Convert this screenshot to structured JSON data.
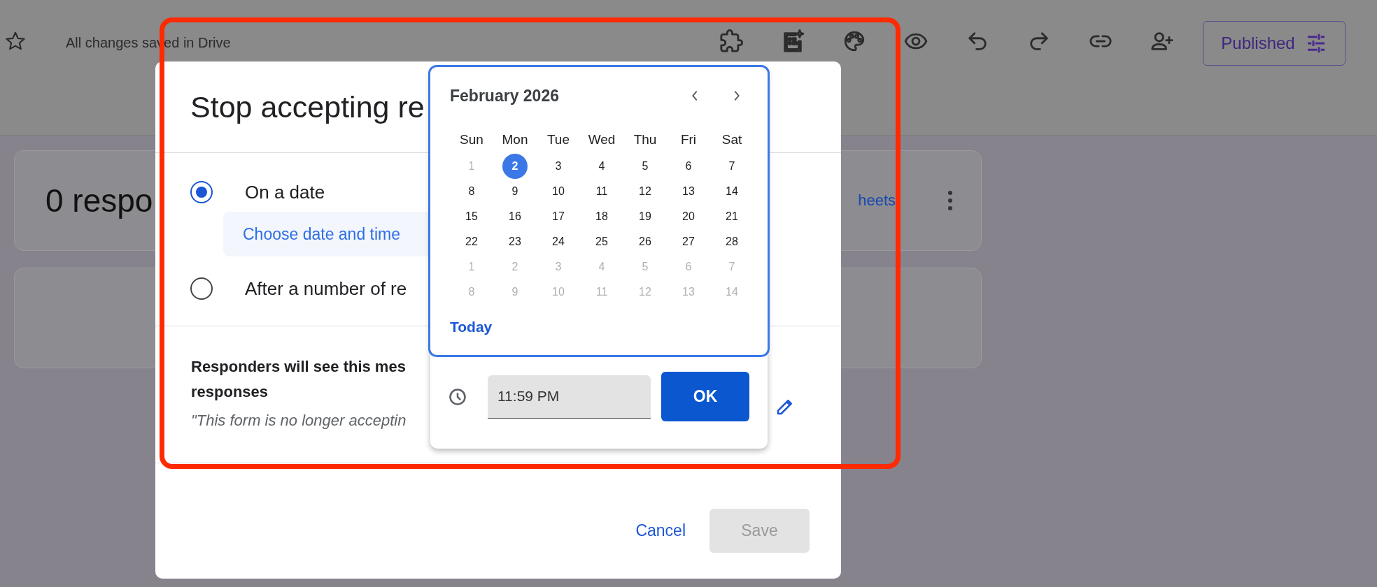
{
  "header": {
    "status": "All changes saved in Drive",
    "publish_button": "Published"
  },
  "summary_card": {
    "title": "0 respo",
    "link": "heets"
  },
  "dialog": {
    "title": "Stop accepting re",
    "options": [
      {
        "label": "On a date",
        "selected": true,
        "action": "Choose date and time"
      },
      {
        "label": "After a number of re",
        "selected": false
      }
    ],
    "message_heading": [
      "Responders will see this mes",
      "responses"
    ],
    "message": "\"This form is no longer acceptin",
    "cancel": "Cancel",
    "save": {
      "label": "Save",
      "disabled": true
    }
  },
  "date_picker": {
    "month": "February 2026",
    "weekdays": [
      "Sun",
      "Mon",
      "Tue",
      "Wed",
      "Thu",
      "Fri",
      "Sat"
    ],
    "days": [
      {
        "label": "1",
        "disabled": true,
        "selected": false
      },
      {
        "label": "2",
        "disabled": false,
        "selected": true
      },
      {
        "label": "3",
        "disabled": false,
        "selected": false
      },
      {
        "label": "4",
        "disabled": false,
        "selected": false
      },
      {
        "label": "5",
        "disabled": false,
        "selected": false
      },
      {
        "label": "6",
        "disabled": false,
        "selected": false
      },
      {
        "label": "7",
        "disabled": false,
        "selected": false
      },
      {
        "label": "8",
        "disabled": false,
        "selected": false
      },
      {
        "label": "9",
        "disabled": false,
        "selected": false
      },
      {
        "label": "10",
        "disabled": false,
        "selected": false
      },
      {
        "label": "11",
        "disabled": false,
        "selected": false
      },
      {
        "label": "12",
        "disabled": false,
        "selected": false
      },
      {
        "label": "13",
        "disabled": false,
        "selected": false
      },
      {
        "label": "14",
        "disabled": false,
        "selected": false
      },
      {
        "label": "15",
        "disabled": false,
        "selected": false
      },
      {
        "label": "16",
        "disabled": false,
        "selected": false
      },
      {
        "label": "17",
        "disabled": false,
        "selected": false
      },
      {
        "label": "18",
        "disabled": false,
        "selected": false
      },
      {
        "label": "19",
        "disabled": false,
        "selected": false
      },
      {
        "label": "20",
        "disabled": false,
        "selected": false
      },
      {
        "label": "21",
        "disabled": false,
        "selected": false
      },
      {
        "label": "22",
        "disabled": false,
        "selected": false
      },
      {
        "label": "23",
        "disabled": false,
        "selected": false
      },
      {
        "label": "24",
        "disabled": false,
        "selected": false
      },
      {
        "label": "25",
        "disabled": false,
        "selected": false
      },
      {
        "label": "26",
        "disabled": false,
        "selected": false
      },
      {
        "label": "27",
        "disabled": false,
        "selected": false
      },
      {
        "label": "28",
        "disabled": false,
        "selected": false
      },
      {
        "label": "1",
        "disabled": true,
        "selected": false
      },
      {
        "label": "2",
        "disabled": true,
        "selected": false
      },
      {
        "label": "3",
        "disabled": true,
        "selected": false
      },
      {
        "label": "4",
        "disabled": true,
        "selected": false
      },
      {
        "label": "5",
        "disabled": true,
        "selected": false
      },
      {
        "label": "6",
        "disabled": true,
        "selected": false
      },
      {
        "label": "7",
        "disabled": true,
        "selected": false
      },
      {
        "label": "8",
        "disabled": true,
        "selected": false
      },
      {
        "label": "9",
        "disabled": true,
        "selected": false
      },
      {
        "label": "10",
        "disabled": true,
        "selected": false
      },
      {
        "label": "11",
        "disabled": true,
        "selected": false
      },
      {
        "label": "12",
        "disabled": true,
        "selected": false
      },
      {
        "label": "13",
        "disabled": true,
        "selected": false
      },
      {
        "label": "14",
        "disabled": true,
        "selected": false
      }
    ],
    "today_link": "Today",
    "time": "11:59 PM",
    "ok": "OK"
  }
}
